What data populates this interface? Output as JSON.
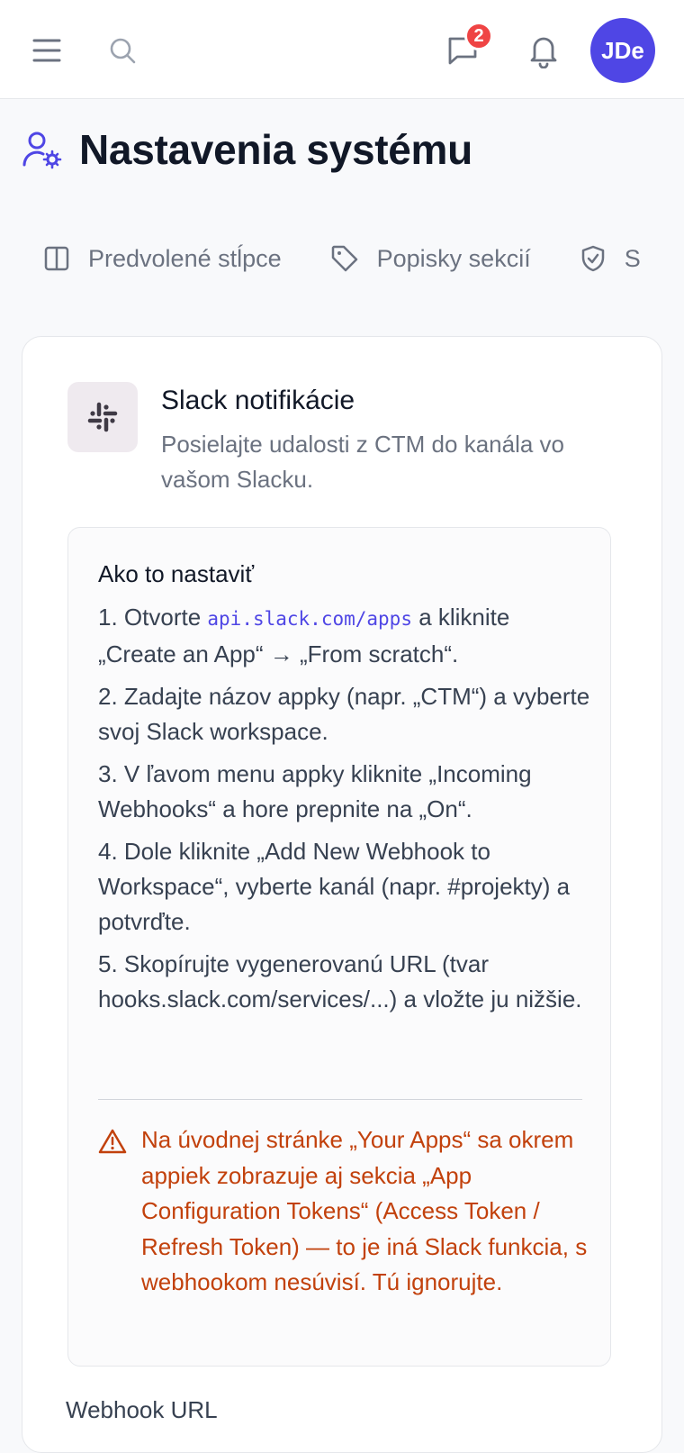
{
  "topbar": {
    "chat_badge_count": "2",
    "avatar_initials": "JDe",
    "accent_color": "#4f46e5",
    "badge_color": "#ef4444"
  },
  "page": {
    "title": "Nastavenia systému"
  },
  "tabs": [
    {
      "label": "Predvolené stĺpce",
      "icon": "columns-icon"
    },
    {
      "label": "Popisky sekcií",
      "icon": "tag-icon"
    },
    {
      "label": "S",
      "icon": "shield-check-icon"
    }
  ],
  "slack": {
    "title": "Slack notifikácie",
    "description": "Posielajte udalosti z CTM do kanála vo vašom Slacku.",
    "howto_title": "Ako to nastaviť",
    "step1_pre": "1. Otvorte ",
    "step1_code": "api.slack.com/apps",
    "step1_post": " a kliknite „Create an App“ → „From scratch“.",
    "step2": "2. Zadajte názov appky (napr. „CTM“) a vyberte svoj Slack workspace.",
    "step3": "3. V ľavom menu appky kliknite „Incoming Webhooks“ a hore prepnite na „On“.",
    "step4": "4. Dole kliknite „Add New Webhook to Workspace“, vyberte kanál (napr. #projekty) a potvrďte.",
    "step5": "5. Skopírujte vygenerovanú URL (tvar hooks.slack.com/services/...) a vložte ju nižšie.",
    "warning": "Na úvodnej stránke „Your Apps“ sa okrem appiek zobrazuje aj sekcia „App Configuration Tokens“ (Access Token / Refresh Token) — to je iná Slack funkcia, s webhookom nesúvisí. Tú ignorujte.",
    "warning_color": "#c2410c",
    "webhook_label": "Webhook URL"
  }
}
